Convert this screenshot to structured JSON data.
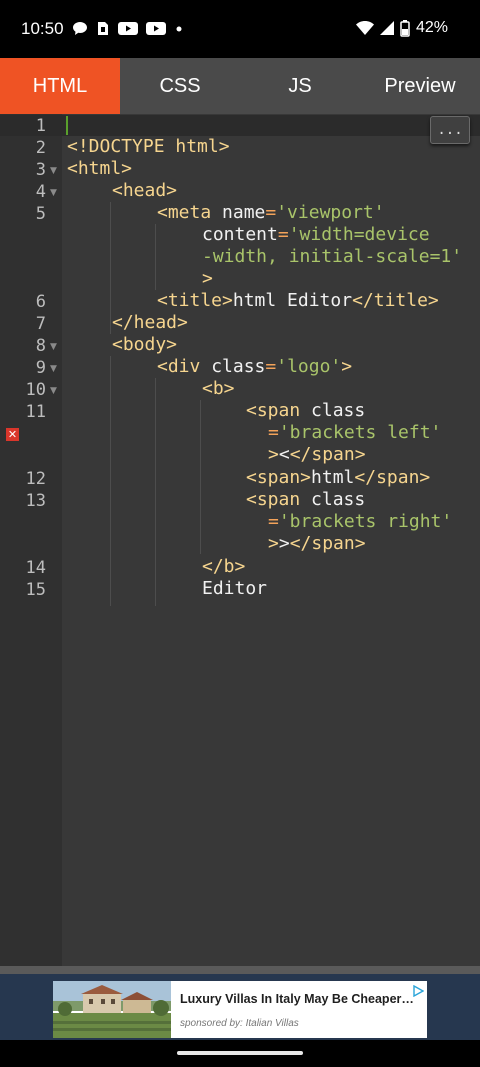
{
  "status_bar": {
    "time": "10:50",
    "battery": "42%",
    "left_icons": [
      "chat-bubble-icon",
      "sim-card-icon",
      "youtube-icon",
      "youtube-icon",
      "dot-icon"
    ],
    "right_icons": [
      "wifi-icon",
      "signal-icon",
      "battery-icon"
    ]
  },
  "tabs": [
    {
      "label": "HTML",
      "active": true
    },
    {
      "label": "CSS",
      "active": false
    },
    {
      "label": "JS",
      "active": false
    },
    {
      "label": "Preview",
      "active": false
    }
  ],
  "colors": {
    "accent": "#ef5324",
    "tag": "#f6d58f",
    "string": "#a9c46a",
    "equals": "#f4a35a",
    "error": "#d9362b"
  },
  "editor": {
    "more_button": "...",
    "line_numbers": [
      "1",
      "2",
      "3",
      "4",
      "5",
      "6",
      "7",
      "8",
      "9",
      "10",
      "11",
      "12",
      "13",
      "14",
      "15"
    ],
    "error_line": "11",
    "lines": {
      "l2": "<!DOCTYPE html>",
      "l3": "<html>",
      "l4": "<head>",
      "l5_tag": "<meta",
      "l5_attr": " name",
      "l5_eq": "=",
      "l5_str": "'viewport'",
      "l5b_attr": "content",
      "l5b_eq": "=",
      "l5b_str": "'width=device",
      "l5c_str": "-width, initial-scale=1'",
      "l5d_tag": ">",
      "l6_open": "<title>",
      "l6_text": "html Editor",
      "l6_close": "</title>",
      "l7": "</head>",
      "l8": "<body>",
      "l9_tag": "<div",
      "l9_attr": " class",
      "l9_eq": "=",
      "l9_str": "'logo'",
      "l9_close": ">",
      "l10": "<b>",
      "l11_tag": "<span",
      "l11_attr": " class",
      "l11b_eq": "=",
      "l11b_str": "'brackets left'",
      "l11c_gt": ">",
      "l11c_text": "<",
      "l11c_close": "</span>",
      "l12_open": "<span>",
      "l12_text": "html",
      "l12_close": "</span>",
      "l13_tag": "<span",
      "l13_attr": " class",
      "l13b_eq": "=",
      "l13b_str": "'brackets right'",
      "l13c_gt": ">",
      "l13c_text": ">",
      "l13c_close": "</span>",
      "l14": "</b>",
      "l15": "Editor"
    }
  },
  "ad": {
    "title": "Luxury Villas In Italy May Be Cheaper…",
    "sponsor": "sponsored by: Italian Villas"
  }
}
